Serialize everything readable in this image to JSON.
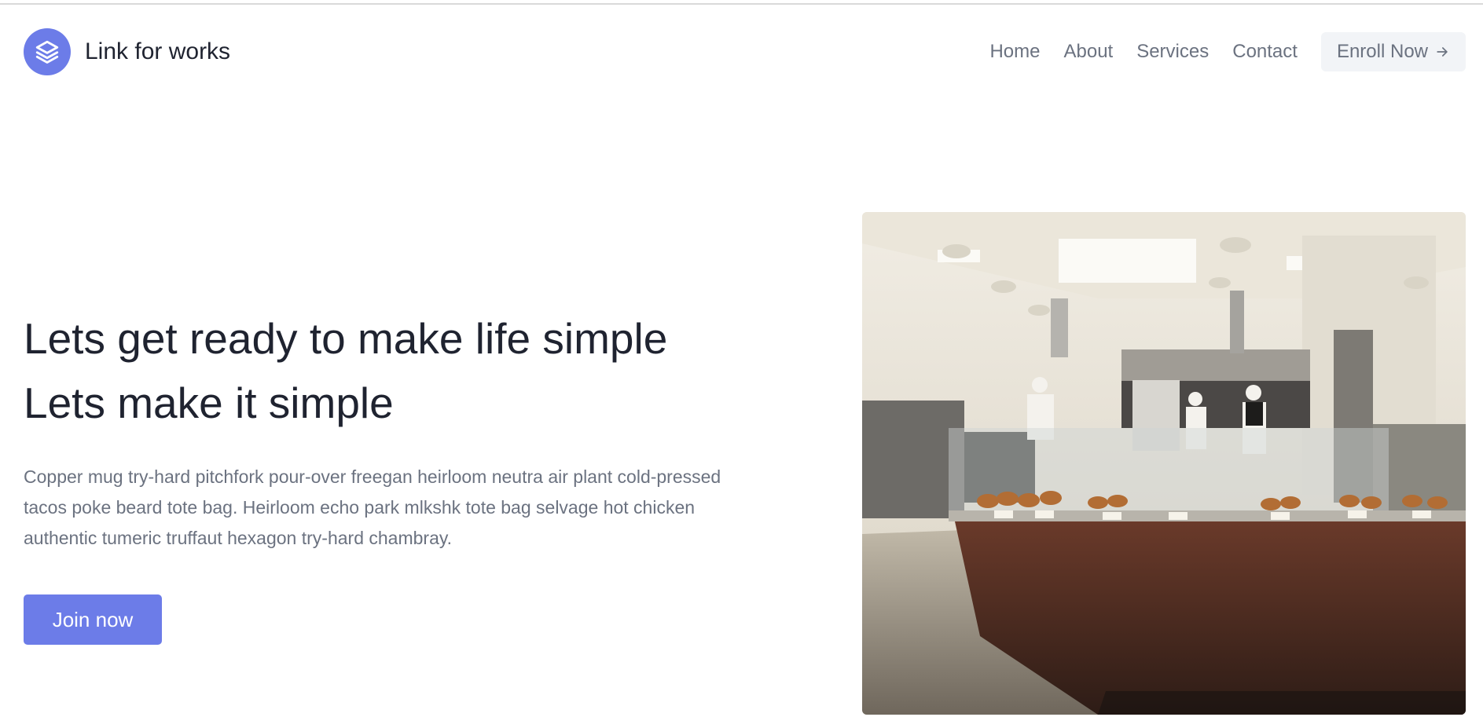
{
  "brand": {
    "name": "Link for works",
    "logo_icon": "stacked-layers-icon",
    "accent": "#6c7ce8"
  },
  "nav": {
    "links": [
      "Home",
      "About",
      "Services",
      "Contact"
    ],
    "cta_label": "Enroll Now",
    "cta_icon": "arrow-right-icon"
  },
  "hero": {
    "title_line1": "Lets get ready to make life simple",
    "title_line2": "Lets make it simple",
    "description": "Copper mug try-hard pitchfork pour-over freegan heirloom neutra air plant cold-pressed tacos poke beard tote bag. Heirloom echo park mlkshk tote bag selvage hot chicken authentic tumeric truffaut hexagon try-hard chambray.",
    "button_label": "Join now"
  },
  "image": {
    "subject": "bakery-kitchen-photo"
  }
}
